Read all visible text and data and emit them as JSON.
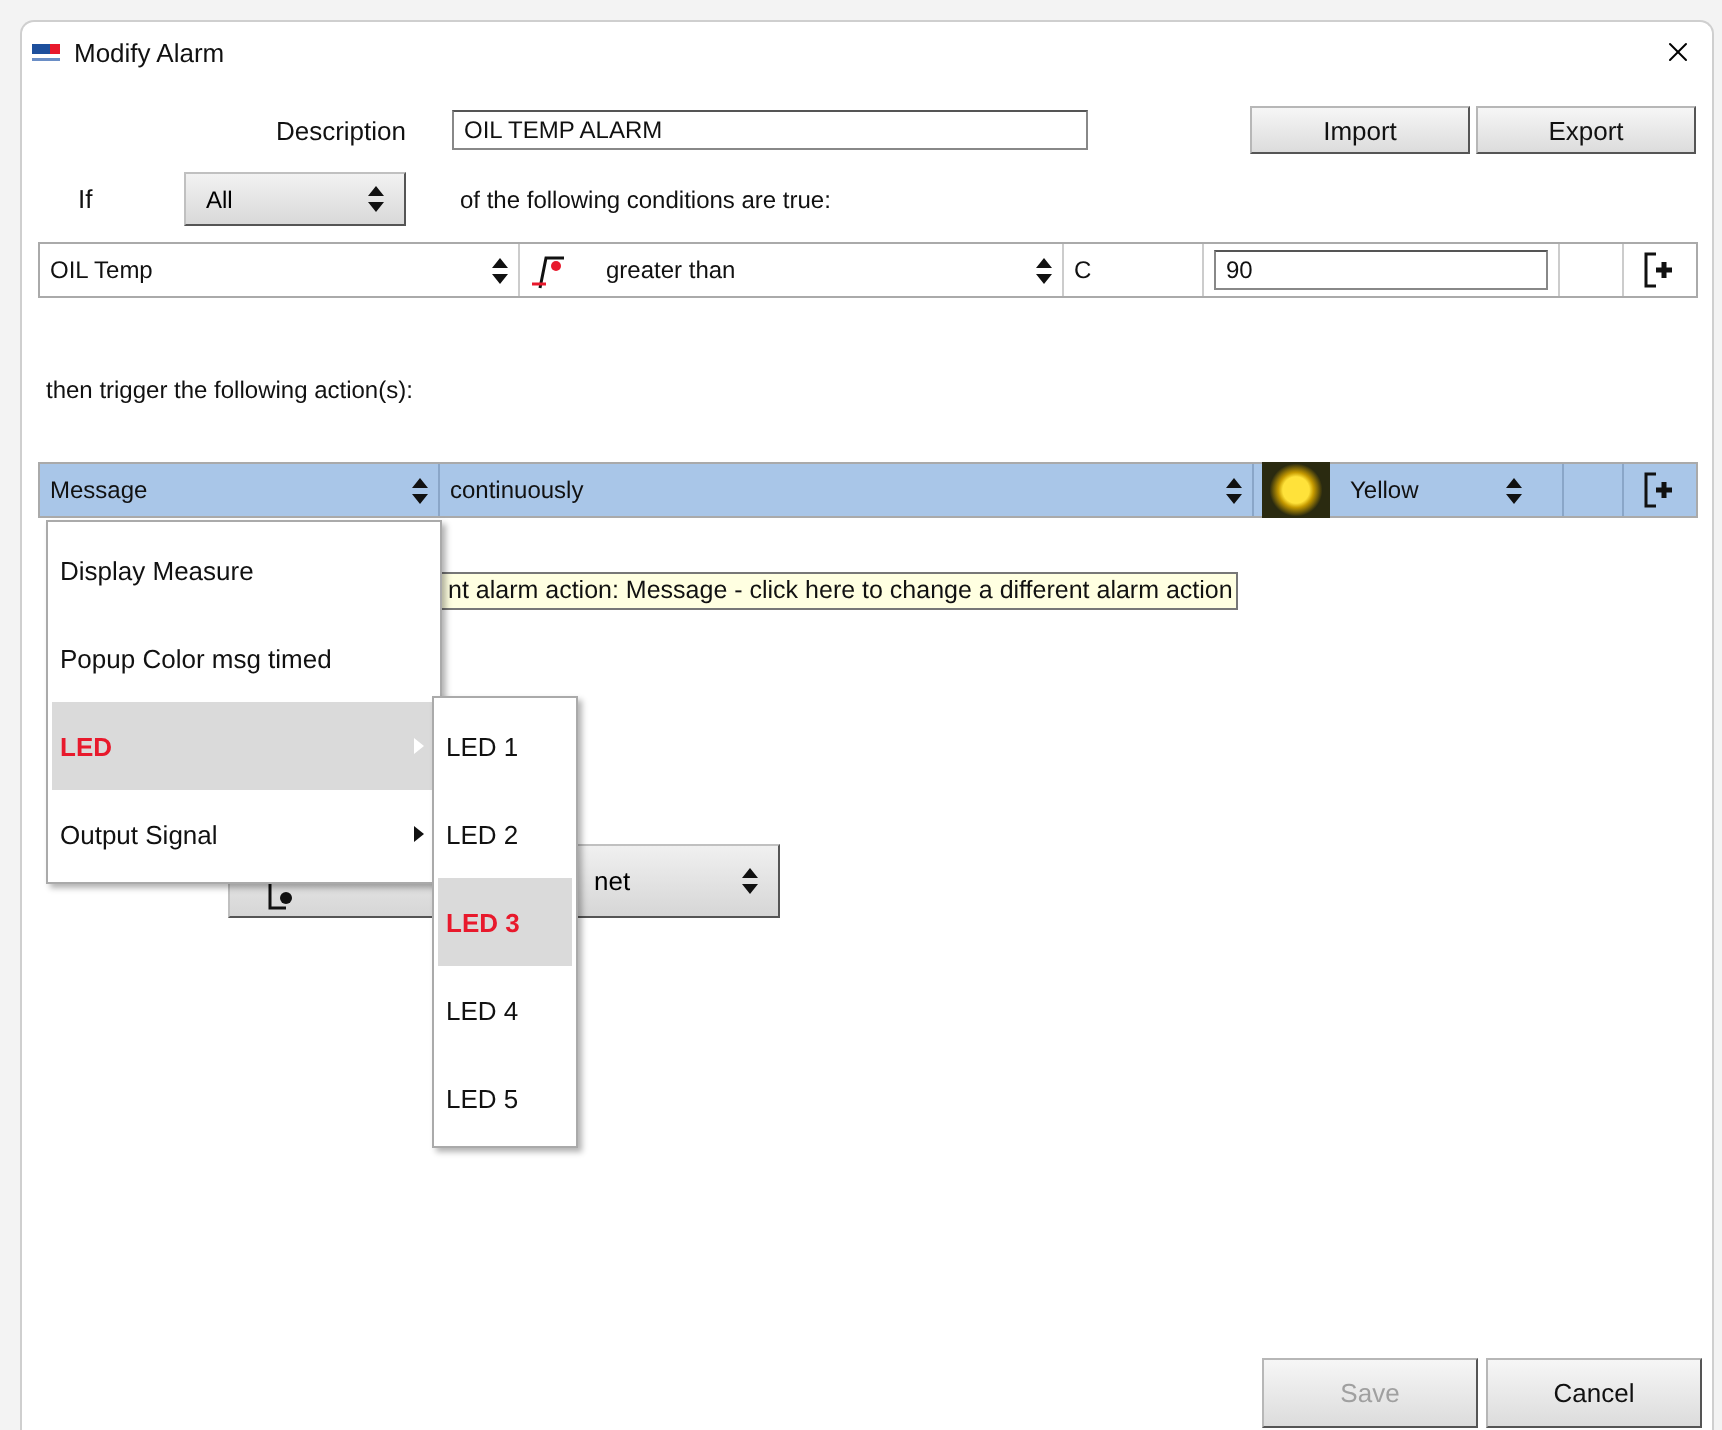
{
  "window": {
    "title": "Modify Alarm"
  },
  "description": {
    "label": "Description",
    "value": "OIL TEMP ALARM"
  },
  "top_buttons": [
    {
      "label": "Import"
    },
    {
      "label": "Export"
    }
  ],
  "if_row": {
    "label": "If",
    "mode": "All",
    "suffix": "of the following conditions are true:"
  },
  "conditions": [
    {
      "channel": "OIL Temp",
      "operator": "greater than",
      "unit": "C",
      "value": "90"
    }
  ],
  "actions_heading": "then trigger the following action(s):",
  "actions": [
    {
      "type": "Message",
      "timing": "continuously",
      "color_name": "Yellow",
      "selected": true
    }
  ],
  "tooltip": "nt alarm action: Message - click here to change a different alarm action",
  "action_menu": [
    {
      "label": "Display Measure",
      "selected": false,
      "has_submenu": false
    },
    {
      "label": "Popup Color msg timed",
      "selected": false,
      "has_submenu": false
    },
    {
      "label": "LED",
      "selected": true,
      "has_submenu": true
    },
    {
      "label": "Output Signal",
      "selected": false,
      "has_submenu": true
    }
  ],
  "submenu": [
    {
      "label": "LED 1",
      "selected": false
    },
    {
      "label": "LED 2",
      "selected": false
    },
    {
      "label": "LED 3",
      "selected": true
    },
    {
      "label": "LED 4",
      "selected": false
    },
    {
      "label": "LED 5",
      "selected": false
    }
  ],
  "covered_button": {
    "label": "net"
  },
  "footer_buttons": [
    {
      "label": "Save",
      "disabled": true
    },
    {
      "label": "Cancel",
      "disabled": false
    }
  ]
}
